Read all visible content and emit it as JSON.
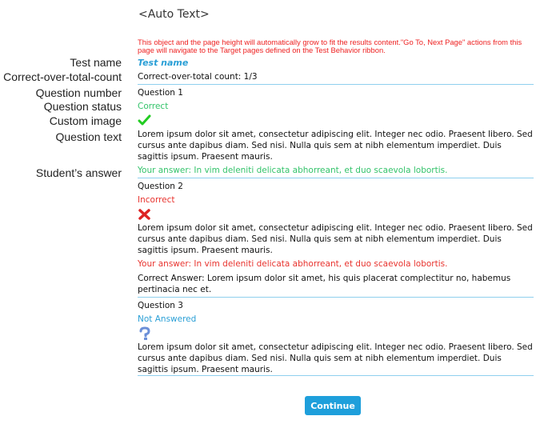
{
  "auto_text": "<Auto Text>",
  "warning": "This object and the page height will automatically grow to fit the results content.\"Go To, Next Page\" actions from this page will navigate to the Target pages defined on the Test Behavior ribbon.",
  "labels": {
    "test_name": "Test name",
    "count": "Correct-over-total-count",
    "question_number": "Question number",
    "question_status": "Question status",
    "custom_image": "Custom image",
    "question_text": "Question text",
    "student_answer": "Student’s answer"
  },
  "results": {
    "test_name": "Test name",
    "count": "Correct-over-total count: 1/3",
    "questions": [
      {
        "number": "Question 1",
        "status": "Correct",
        "icon": "checkmark-icon",
        "text": "Lorem ipsum dolor sit amet, consectetur adipiscing elit. Integer nec odio. Praesent libero. Sed cursus ante dapibus diam. Sed nisi. Nulla quis sem at nibh elementum imperdiet. Duis sagittis ipsum. Praesent mauris.",
        "answer": "Your answer: In vim deleniti delicata abhorreant, et duo scaevola lobortis."
      },
      {
        "number": "Question 2",
        "status": "Incorrect",
        "icon": "cross-icon",
        "text": "Lorem ipsum dolor sit amet, consectetur adipiscing elit. Integer nec odio. Praesent libero. Sed cursus ante dapibus diam. Sed nisi. Nulla quis sem at nibh elementum imperdiet. Duis sagittis ipsum. Praesent mauris.",
        "answer": "Your answer: In vim deleniti delicata abhorreant, et duo scaevola lobortis.",
        "correct_answer": "Correct Answer: Lorem ipsum dolor sit amet, his quis placerat complectitur  no, habemus pertinacia nec et."
      },
      {
        "number": "Question 3",
        "status": "Not Answered",
        "icon": "question-mark-icon",
        "text": "Lorem ipsum dolor sit amet, consectetur adipiscing elit. Integer nec odio. Praesent libero. Sed cursus ante dapibus diam. Sed nisi. Nulla quis sem at nibh elementum imperdiet. Duis sagittis ipsum. Praesent mauris."
      }
    ]
  },
  "continue_label": "Continue",
  "colors": {
    "correct": "#33c36a",
    "incorrect": "#e8332e",
    "not_answered": "#2a9fd6",
    "divider": "#8fd0ee",
    "button": "#1e9fdb",
    "warning": "#ee2222"
  }
}
